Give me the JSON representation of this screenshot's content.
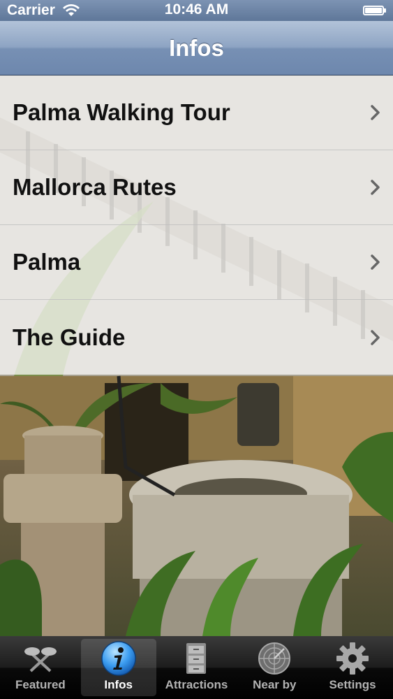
{
  "status_bar": {
    "carrier": "Carrier",
    "time": "10:46 AM"
  },
  "nav": {
    "title": "Infos"
  },
  "menu": {
    "items": [
      {
        "label": "Palma Walking Tour"
      },
      {
        "label": "Mallorca Rutes"
      },
      {
        "label": "Palma"
      },
      {
        "label": "The Guide"
      }
    ]
  },
  "tab_bar": {
    "active": "Infos",
    "tabs": [
      {
        "label": "Featured",
        "icon": "featured-icon"
      },
      {
        "label": "Infos",
        "icon": "info-icon"
      },
      {
        "label": "Attractions",
        "icon": "cabinet-icon"
      },
      {
        "label": "Near by",
        "icon": "radar-icon"
      },
      {
        "label": "Settings",
        "icon": "gear-icon"
      }
    ]
  }
}
